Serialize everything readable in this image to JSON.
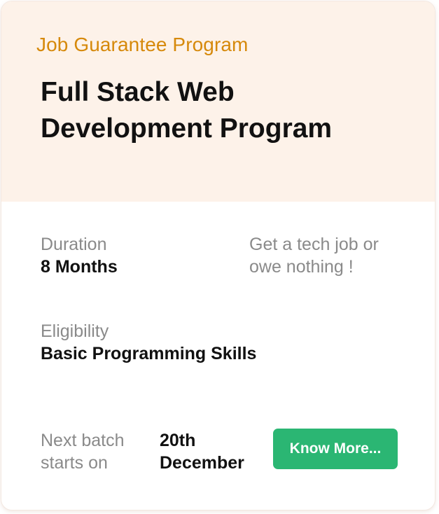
{
  "program": {
    "kicker": "Job Guarantee Program",
    "title": "Full Stack Web Development Program"
  },
  "details": {
    "duration_label": "Duration",
    "duration_value": "8 Months",
    "guarantee_text": "Get a tech job or\nowe nothing !",
    "eligibility_label": "Eligibility",
    "eligibility_value": "Basic Programming Skills"
  },
  "batch": {
    "label": "Next batch\nstarts on",
    "date": "20th\nDecember"
  },
  "cta": {
    "label": "Know More..."
  },
  "colors": {
    "header_bg": "#fdf2e9",
    "kicker": "#d6890b",
    "button": "#2bb673"
  }
}
